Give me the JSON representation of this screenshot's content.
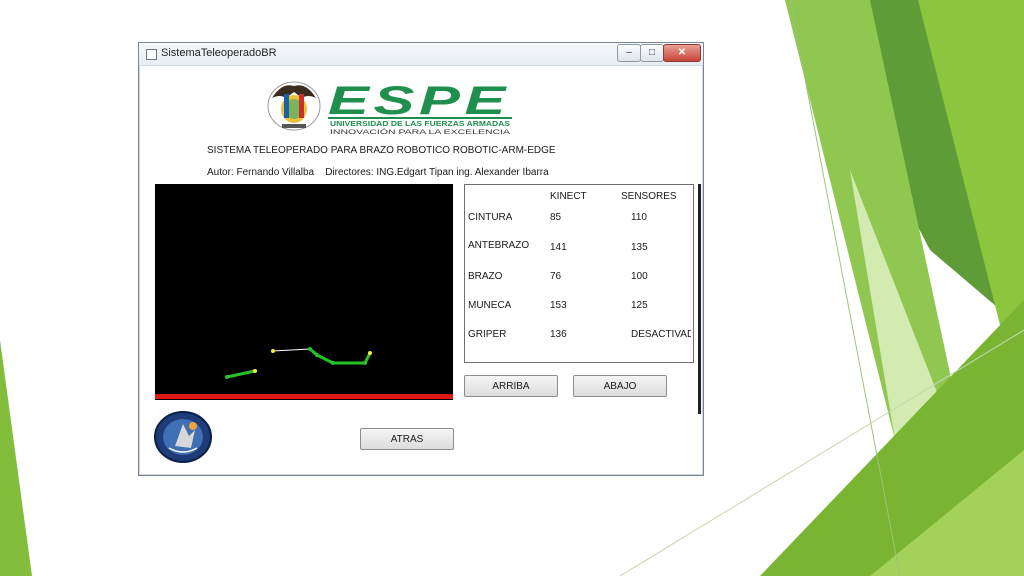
{
  "window": {
    "title": "SistemaTeleoperadoBR",
    "min_glyph": "–",
    "max_glyph": "□",
    "close_glyph": "✕"
  },
  "header": {
    "logo_text": "ESPE",
    "logo_subtitle": "UNIVERSIDAD DE LAS FUERZAS ARMADAS",
    "logo_tagline": "INNOVACIÓN PARA LA EXCELENCIA",
    "system_title": "SISTEMA TELEOPERADO PARA BRAZO ROBOTICO ROBOTIC-ARM-EDGE",
    "authors": "Autor: Fernando Villalba    Directores: ING.Edgart Tipan ing. Alexander Ibarra"
  },
  "table": {
    "col_kinect": "KINECT",
    "col_sensores": "SENSORES",
    "rows": [
      {
        "label": "CINTURA",
        "kinect": "85",
        "sensores": "110"
      },
      {
        "label": "ANTEBRAZO",
        "kinect": "141",
        "sensores": "135"
      },
      {
        "label": "BRAZO",
        "kinect": "76",
        "sensores": "100"
      },
      {
        "label": "MUÑECA",
        "kinect": "153",
        "sensores": "125"
      },
      {
        "label": "GRIPER",
        "kinect": "136",
        "sensores": "DESACTIVADO"
      }
    ]
  },
  "buttons": {
    "arriba": "ARRIBA",
    "abajo": "ABAJO",
    "atras": "ATRAS"
  },
  "colors": {
    "logo_green": "#1f8f4e",
    "skeleton_green": "#27c227",
    "skeleton_yellow": "#f0f040",
    "red_bar": "#e01818",
    "slide_green_light": "#9ccc3c",
    "slide_green_dark": "#4f8f2a"
  }
}
